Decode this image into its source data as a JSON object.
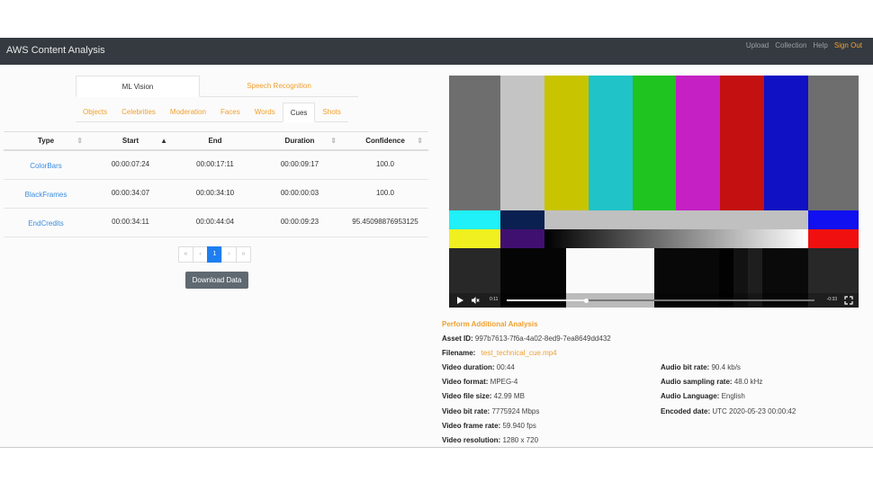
{
  "app": {
    "title": "AWS Content Analysis",
    "nav": [
      "Upload",
      "Collection",
      "Help",
      "Sign Out"
    ]
  },
  "tabs": {
    "main": [
      "ML Vision",
      "Speech Recognition"
    ],
    "active_main": "ML Vision",
    "sub": [
      "Objects",
      "Celebrities",
      "Moderation",
      "Faces",
      "Words",
      "Cues",
      "Shots"
    ],
    "active_sub": "Cues"
  },
  "table": {
    "headers": [
      "Type",
      "Start",
      "End",
      "Duration",
      "Confidence"
    ],
    "rows": [
      [
        "ColorBars",
        "00:00:07:24",
        "00:00:17:11",
        "00:00:09:17",
        "100.0"
      ],
      [
        "BlackFrames",
        "00:00:34:07",
        "00:00:34:10",
        "00:00:00:03",
        "100.0"
      ],
      [
        "EndCredits",
        "00:00:34:11",
        "00:00:44:04",
        "00:00:09:23",
        "95.45098876953125"
      ]
    ]
  },
  "pagination": {
    "items": [
      "«",
      "‹",
      "1",
      "›",
      "»"
    ],
    "current": "1"
  },
  "download_label": "Download Data",
  "video": {
    "current_time": "0:11",
    "remaining_time": "-0:33",
    "progress": 0.26,
    "icons": [
      "play-icon",
      "mute-icon",
      "fullscreen-icon"
    ]
  },
  "details": {
    "perform_label": "Perform Additional Analysis",
    "asset_label": "Asset ID:",
    "asset_id": "997b7613-7f6a-4a02-8ed9-7ea8649dd432",
    "filename_label": "Filename:",
    "filename": "test_technical_cue.mp4",
    "left": [
      {
        "label": "Video duration:",
        "value": "00:44"
      },
      {
        "label": "Video format:",
        "value": "MPEG-4"
      },
      {
        "label": "Video file size:",
        "value": "42.99 MB"
      },
      {
        "label": "Video bit rate:",
        "value": "7775924 Mbps"
      },
      {
        "label": "Video frame rate:",
        "value": "59.940 fps"
      },
      {
        "label": "Video resolution:",
        "value": "1280 x 720"
      }
    ],
    "right": [
      {
        "label": "Audio bit rate:",
        "value": "90.4 kb/s"
      },
      {
        "label": "Audio sampling rate:",
        "value": "48.0 kHz"
      },
      {
        "label": "Audio Language:",
        "value": "English"
      },
      {
        "label": "Encoded date:",
        "value": "UTC 2020-05-23 00:00:42"
      }
    ]
  },
  "colors": {
    "navbar": "#343a40",
    "accent": "#f0a030",
    "link": "#3b8ee0",
    "active_page": "#1e7ef0",
    "button": "#5f6971"
  }
}
